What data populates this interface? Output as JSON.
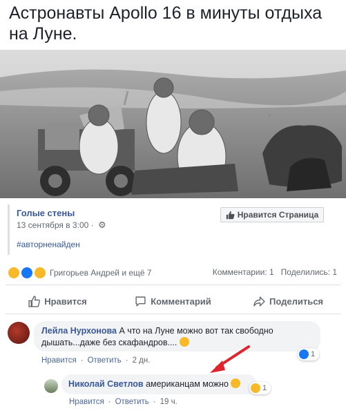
{
  "post": {
    "title": "Астронавты Apollo 16 в минуты отдыха на Луне."
  },
  "shared_page": {
    "name": "Голые стены",
    "time": "13 сентября в 3:00 ·",
    "hashtag": "#авторненайден",
    "like_button_label": "Нравится Страница"
  },
  "reactions": {
    "icons": [
      "haha-emoji",
      "like-icon",
      "wow-emoji"
    ],
    "summary": "Григорьев Андрей и ещё 7",
    "comments_count": "Комментарии: 1",
    "shares_count": "Поделились: 1"
  },
  "actions": {
    "like": "Нравится",
    "comment": "Комментарий",
    "share": "Поделиться"
  },
  "comments": [
    {
      "author": "Лейла Нурхонова",
      "text": "А что на Луне можно вот так свободно дышать...даже без скафандров....",
      "like": "Нравится",
      "reply": "Ответить",
      "age": "2 дн.",
      "reaction_count": "1"
    },
    {
      "author": "Николай Светлов",
      "text": "американцам можно",
      "like": "Нравится",
      "reply": "Ответить",
      "age": "19 ч.",
      "reaction_count": "1"
    }
  ],
  "colors": {
    "link": "#385898",
    "annotation_arrow": "#e0242d",
    "emoji_yellow": "#f7b928",
    "like_blue": "#1877f2"
  }
}
